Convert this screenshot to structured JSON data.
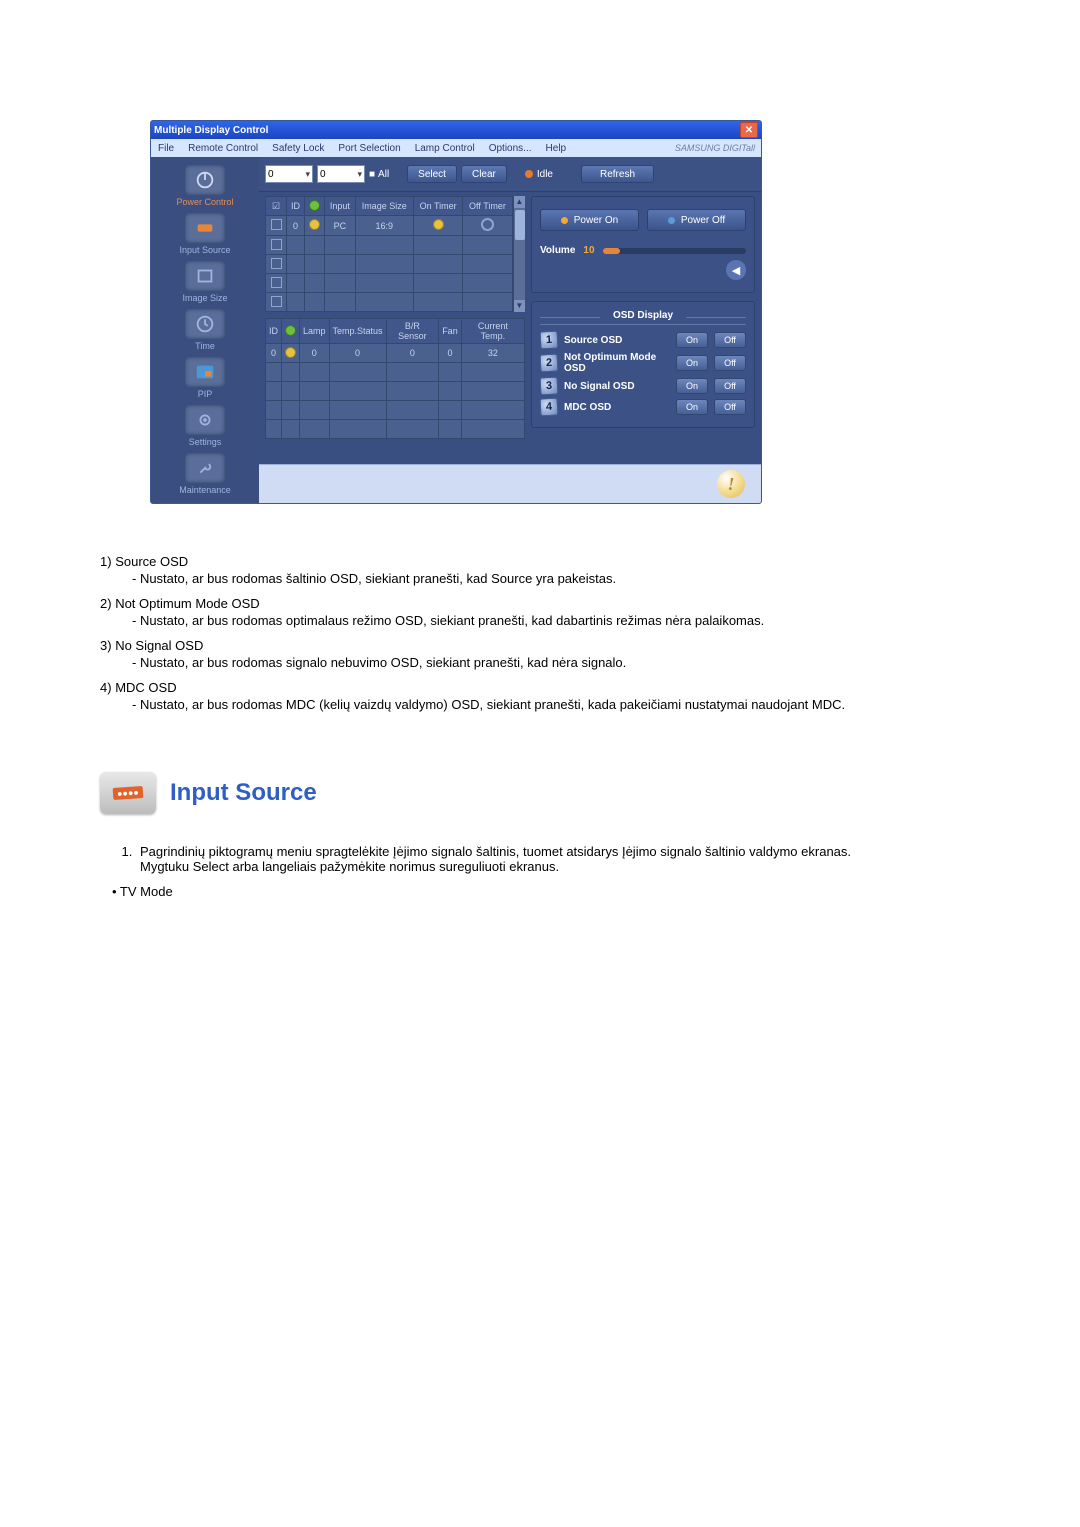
{
  "app": {
    "title": "Multiple Display Control",
    "brand": "SAMSUNG DIGITall",
    "menus": [
      "File",
      "Remote Control",
      "Safety Lock",
      "Port Selection",
      "Lamp Control",
      "Options...",
      "Help"
    ],
    "toolbar": {
      "combo1": "0",
      "combo2": "0",
      "all_label": "All",
      "select_label": "Select",
      "clear_label": "Clear",
      "idle_label": "Idle",
      "refresh_label": "Refresh"
    },
    "sidebar": [
      {
        "label": "Power Control"
      },
      {
        "label": "Input Source"
      },
      {
        "label": "Image Size"
      },
      {
        "label": "Time"
      },
      {
        "label": "PIP"
      },
      {
        "label": "Settings"
      },
      {
        "label": "Maintenance"
      }
    ],
    "grid1": {
      "headers": [
        "",
        "ID",
        "",
        "Input",
        "Image Size",
        "On Timer",
        "Off Timer"
      ],
      "row": {
        "id": "0",
        "input": "PC",
        "size": "16:9"
      }
    },
    "grid2": {
      "headers": [
        "ID",
        "",
        "Lamp",
        "Temp.Status",
        "B/R Sensor",
        "Fan",
        "Current Temp."
      ],
      "row": {
        "id": "0",
        "lamp": "0",
        "temp_s": "0",
        "br": "0",
        "fan": "0",
        "ct": "32"
      }
    },
    "power": {
      "on": "Power On",
      "off": "Power Off",
      "volume_label": "Volume",
      "volume_value": "10"
    },
    "osd": {
      "title": "OSD Display",
      "rows": [
        {
          "n": "1",
          "label": "Source OSD",
          "on": "On",
          "off": "Off"
        },
        {
          "n": "2",
          "label": "Not Optimum Mode OSD",
          "on": "On",
          "off": "Off"
        },
        {
          "n": "3",
          "label": "No Signal OSD",
          "on": "On",
          "off": "Off"
        },
        {
          "n": "4",
          "label": "MDC OSD",
          "on": "On",
          "off": "Off"
        }
      ]
    }
  },
  "list": [
    {
      "n": "1)",
      "title": "Source OSD",
      "desc": "- Nustato, ar bus rodomas šaltinio OSD, siekiant pranešti, kad Source yra pakeistas."
    },
    {
      "n": "2)",
      "title": "Not Optimum Mode OSD",
      "desc": "- Nustato, ar bus rodomas optimalaus režimo OSD, siekiant pranešti, kad dabartinis režimas nėra palaikomas."
    },
    {
      "n": "3)",
      "title": "No Signal OSD",
      "desc": "- Nustato, ar bus rodomas signalo nebuvimo OSD, siekiant pranešti, kad nėra signalo."
    },
    {
      "n": "4)",
      "title": "MDC OSD",
      "desc": "- Nustato, ar bus rodomas MDC (kelių vaizdų valdymo) OSD, siekiant pranešti, kada pakeičiami nustatymai naudojant MDC."
    }
  ],
  "section": {
    "title": "Input Source",
    "step": "Pagrindinių piktogramų meniu spragtelėkite Įėjimo signalo šaltinis, tuomet atsidarys Įėjimo signalo šaltinio valdymo ekranas.",
    "step_sub": "Mygtuku Select arba langeliais pažymėkite norimus sureguliuoti ekranus.",
    "bullet": "• TV Mode"
  }
}
